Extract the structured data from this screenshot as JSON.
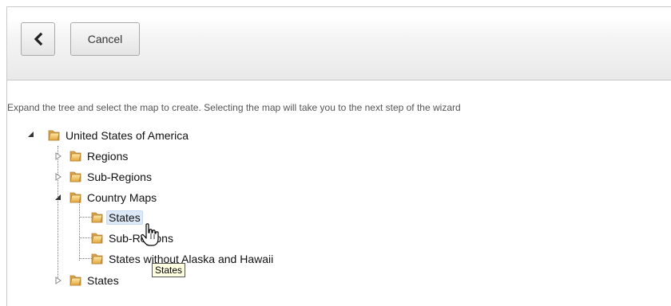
{
  "toolbar": {
    "back_icon": "chevron-left-icon",
    "cancel_label": "Cancel"
  },
  "instructions": "Expand the tree and select the map to create. Selecting the map will take you to the next step of the wizard",
  "tree": {
    "root": {
      "label": "United States of America",
      "expanded": true
    },
    "regions": {
      "label": "Regions",
      "expanded": false
    },
    "sub_regions": {
      "label": "Sub-Regions",
      "expanded": false
    },
    "country_maps": {
      "label": "Country Maps",
      "expanded": true,
      "children": {
        "states": {
          "label": "States"
        },
        "sub_regions": {
          "label": "Sub-Regions"
        },
        "states_without": {
          "label": "States without Alaska and Hawaii"
        }
      }
    },
    "states": {
      "label": "States",
      "expanded": false
    }
  },
  "tooltip": "States",
  "colors": {
    "folder": "#e8b24a",
    "hover_bg": "#dde9f6",
    "tooltip_bg": "#ffffe1"
  }
}
